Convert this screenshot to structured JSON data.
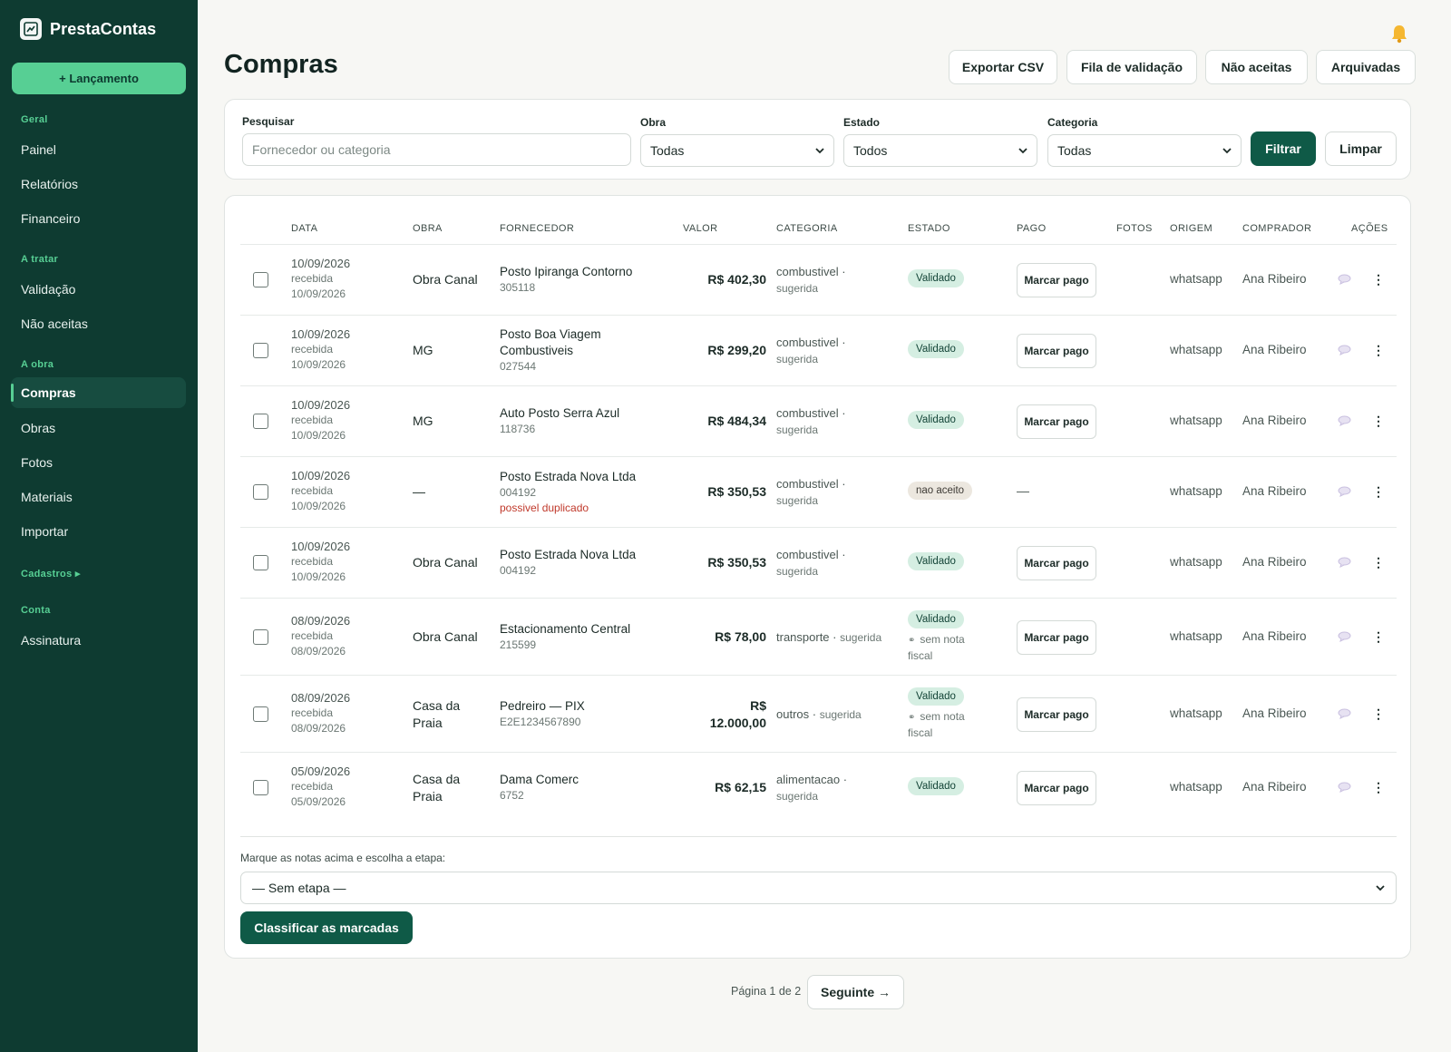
{
  "app": {
    "name": "PrestaContas",
    "new_entry": "+ Lançamento"
  },
  "sidebar": {
    "sections": [
      {
        "title": "Geral",
        "items": [
          "Painel",
          "Relatórios",
          "Financeiro"
        ]
      },
      {
        "title": "A tratar",
        "items": [
          "Validação",
          "Não aceitas"
        ]
      },
      {
        "title": "A obra",
        "items": [
          "Compras",
          "Obras",
          "Fotos",
          "Materiais",
          "Importar"
        ]
      },
      {
        "title": "Cadastros ▸",
        "items": []
      },
      {
        "title": "Conta",
        "items": [
          "Assinatura"
        ]
      }
    ],
    "active": "Compras"
  },
  "header": {
    "title": "Compras",
    "buttons": [
      "Exportar CSV",
      "Fila de validação",
      "Não aceitas",
      "Arquivadas"
    ]
  },
  "filters": {
    "search_label": "Pesquisar",
    "search_placeholder": "Fornecedor ou categoria",
    "obra_label": "Obra",
    "obra_value": "Todas",
    "estado_label": "Estado",
    "estado_value": "Todos",
    "categoria_label": "Categoria",
    "categoria_value": "Todas",
    "filter_button": "Filtrar",
    "clear_button": "Limpar"
  },
  "table": {
    "headers": [
      "DATA",
      "OBRA",
      "FORNECEDOR",
      "VALOR",
      "CATEGORIA",
      "ESTADO",
      "PAGO",
      "FOTOS",
      "ORIGEM",
      "COMPRADOR",
      "AÇÕES"
    ],
    "rows": [
      {
        "date": "10/09/2026",
        "recv_label": "recebida",
        "recv_date": "10/09/2026",
        "obra": "Obra Canal",
        "forn": "Posto Ipiranga Contorno",
        "code": "305118",
        "dup": "",
        "valor": "R$ 402,30",
        "cat": "combustivel ·",
        "cat_s": "sugerida",
        "estado": "Validado",
        "estado_kind": "ok",
        "sem_nota": "",
        "pago": "Marcar pago",
        "origem": "whatsapp",
        "comprador": "Ana Ribeiro"
      },
      {
        "date": "10/09/2026",
        "recv_label": "recebida",
        "recv_date": "10/09/2026",
        "obra": "MG",
        "forn": "Posto Boa Viagem Combustiveis",
        "code": "027544",
        "dup": "",
        "valor": "R$ 299,20",
        "cat": "combustivel ·",
        "cat_s": "sugerida",
        "estado": "Validado",
        "estado_kind": "ok",
        "sem_nota": "",
        "pago": "Marcar pago",
        "origem": "whatsapp",
        "comprador": "Ana Ribeiro"
      },
      {
        "date": "10/09/2026",
        "recv_label": "recebida",
        "recv_date": "10/09/2026",
        "obra": "MG",
        "forn": "Auto Posto Serra Azul",
        "code": "118736",
        "dup": "",
        "valor": "R$ 484,34",
        "cat": "combustivel ·",
        "cat_s": "sugerida",
        "estado": "Validado",
        "estado_kind": "ok",
        "sem_nota": "",
        "pago": "Marcar pago",
        "origem": "whatsapp",
        "comprador": "Ana Ribeiro"
      },
      {
        "date": "10/09/2026",
        "recv_label": "recebida",
        "recv_date": "10/09/2026",
        "obra": "—",
        "forn": "Posto Estrada Nova Ltda",
        "code": "004192",
        "dup": "possivel duplicado",
        "valor": "R$ 350,53",
        "cat": "combustivel ·",
        "cat_s": "sugerida",
        "estado": "nao aceito",
        "estado_kind": "no",
        "sem_nota": "",
        "pago": "—",
        "origem": "whatsapp",
        "comprador": "Ana Ribeiro"
      },
      {
        "date": "10/09/2026",
        "recv_label": "recebida",
        "recv_date": "10/09/2026",
        "obra": "Obra Canal",
        "forn": "Posto Estrada Nova Ltda",
        "code": "004192",
        "dup": "",
        "valor": "R$ 350,53",
        "cat": "combustivel ·",
        "cat_s": "sugerida",
        "estado": "Validado",
        "estado_kind": "ok",
        "sem_nota": "",
        "pago": "Marcar pago",
        "origem": "whatsapp",
        "comprador": "Ana Ribeiro"
      },
      {
        "date": "08/09/2026",
        "recv_label": "recebida",
        "recv_date": "08/09/2026",
        "obra": "Obra Canal",
        "forn": "Estacionamento Central",
        "code": "215599",
        "dup": "",
        "valor": "R$ 78,00",
        "cat": "transporte ·",
        "cat_s": "sugerida",
        "estado": "Validado",
        "estado_kind": "ok",
        "sem_nota": "sem nota fiscal",
        "pago": "Marcar pago",
        "origem": "whatsapp",
        "comprador": "Ana Ribeiro"
      },
      {
        "date": "08/09/2026",
        "recv_label": "recebida",
        "recv_date": "08/09/2026",
        "obra": "Casa da Praia",
        "forn": "Pedreiro — PIX",
        "code": "E2E1234567890",
        "dup": "",
        "valor": "R$ 12.000,00",
        "cat": "outros ·",
        "cat_s": "sugerida",
        "estado": "Validado",
        "estado_kind": "ok",
        "sem_nota": "sem nota fiscal",
        "pago": "Marcar pago",
        "origem": "whatsapp",
        "comprador": "Ana Ribeiro"
      },
      {
        "date": "05/09/2026",
        "recv_label": "recebida",
        "recv_date": "05/09/2026",
        "obra": "Casa da Praia",
        "forn": "Dama Comerc",
        "code": "6752",
        "dup": "",
        "valor": "R$ 62,15",
        "cat": "alimentacao ·",
        "cat_s": "sugerida",
        "estado": "Validado",
        "estado_kind": "ok",
        "sem_nota": "",
        "pago": "Marcar pago",
        "origem": "whatsapp",
        "comprador": "Ana Ribeiro"
      }
    ]
  },
  "bulk": {
    "label": "Marque as notas acima e escolha a etapa:",
    "select_value": "— Sem etapa —",
    "button": "Classificar as marcadas"
  },
  "pagination": {
    "text": "Página 1 de 2",
    "next": "Seguinte →"
  },
  "colors": {
    "sidebar": "#0e3b31",
    "accent": "#57cf94",
    "primary": "#0f5a47"
  },
  "icons": [
    "brand-logo-icon",
    "bell-icon",
    "chevron-down-icon",
    "chat-icon",
    "kebab-menu-icon",
    "clip-icon"
  ]
}
